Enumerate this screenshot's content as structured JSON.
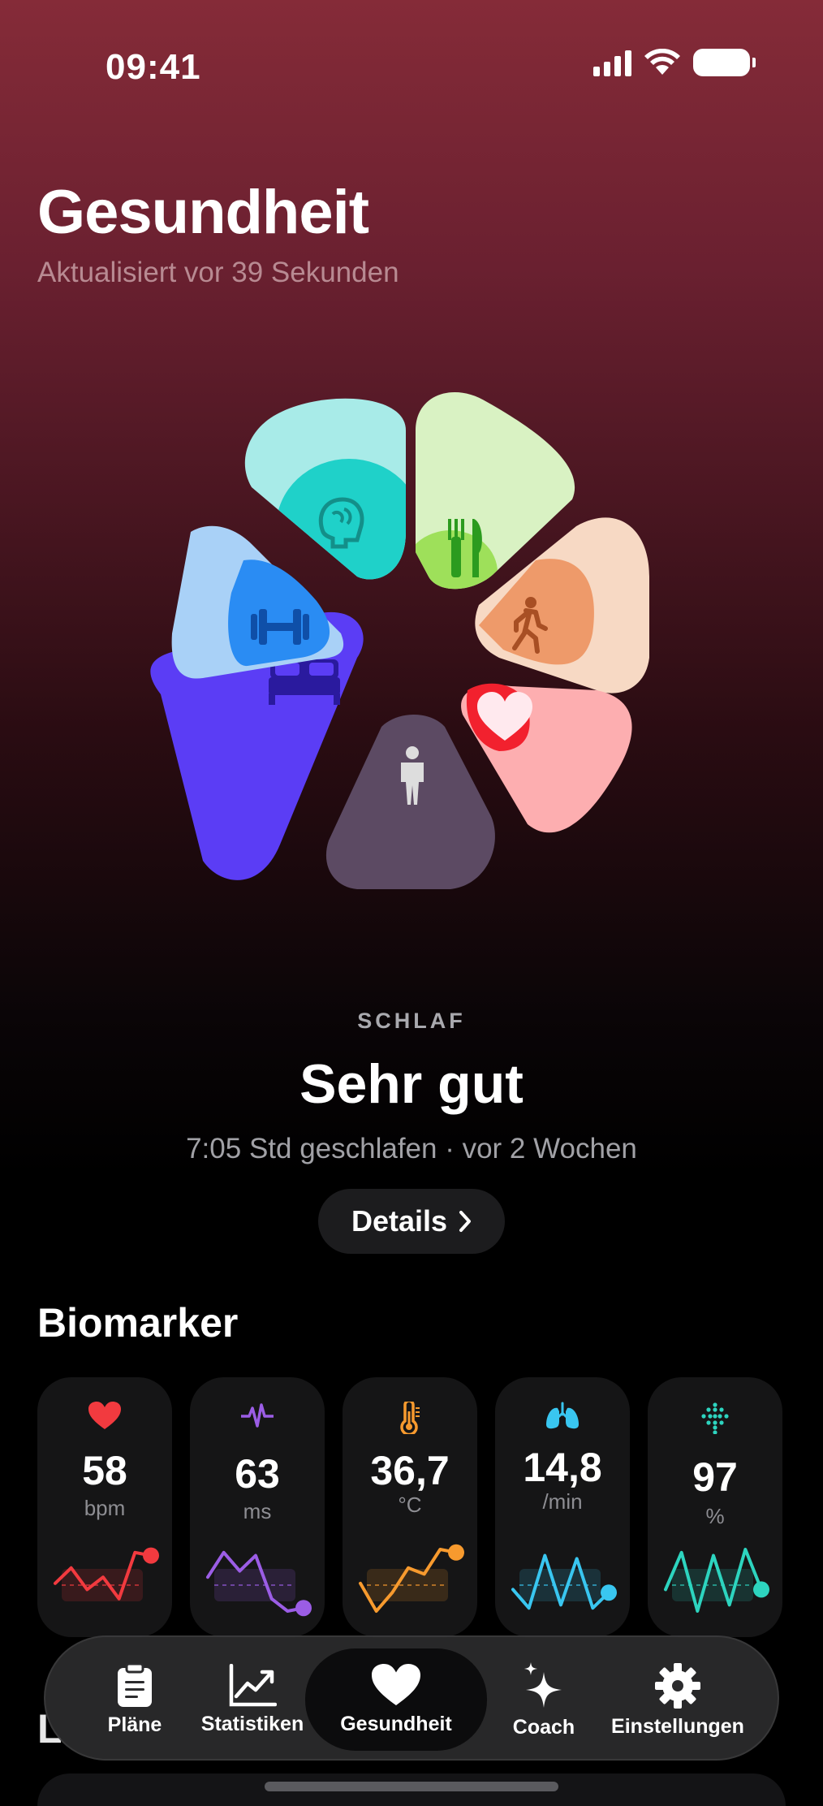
{
  "status_bar": {
    "time": "09:41"
  },
  "header": {
    "title": "Gesundheit",
    "subtitle": "Aktualisiert vor 39 Sekunden"
  },
  "flower": {
    "petals": [
      {
        "name": "mind",
        "icon": "brain-icon",
        "colors": [
          "#a8ebe8",
          "#1fd1c9"
        ]
      },
      {
        "name": "nutrition",
        "icon": "fork-knife-icon",
        "colors": [
          "#d9f2c3",
          "#9ee05a"
        ]
      },
      {
        "name": "activity",
        "icon": "walking-icon",
        "colors": [
          "#f7d9c4",
          "#ee9a6a"
        ]
      },
      {
        "name": "heart",
        "icon": "heart-icon",
        "colors": [
          "#fdaeb0",
          "#f2212e"
        ]
      },
      {
        "name": "body",
        "icon": "person-icon",
        "colors": [
          "#5c4a63",
          "#5c4a63"
        ]
      },
      {
        "name": "sleep",
        "icon": "bed-icon",
        "colors": [
          "#5b3df5",
          "#5b3df5"
        ]
      },
      {
        "name": "fitness",
        "icon": "dumbbell-icon",
        "colors": [
          "#a9d1f7",
          "#2a8cf3"
        ]
      }
    ]
  },
  "summary": {
    "category": "SCHLAF",
    "headline": "Sehr gut",
    "meta": "7:05 Std geschlafen · vor 2 Wochen",
    "details_label": "Details"
  },
  "biomarkers": {
    "title": "Biomarker",
    "cards": [
      {
        "icon": "heart-icon",
        "value": "58",
        "unit": "bpm",
        "color": "#f23a3f",
        "trend": [
          0.45,
          0.7,
          0.35,
          0.55,
          0.2,
          0.95,
          0.9
        ]
      },
      {
        "icon": "heartbeat-icon",
        "value": "63",
        "unit": "ms",
        "color": "#9b5de5",
        "trend": [
          0.55,
          0.95,
          0.65,
          0.9,
          0.2,
          0.0,
          0.05
        ]
      },
      {
        "icon": "thermometer-icon",
        "value": "36,7",
        "unit": "°C",
        "color": "#f79a2e",
        "trend": [
          0.45,
          0.0,
          0.3,
          0.7,
          0.6,
          1.0,
          0.95
        ]
      },
      {
        "icon": "lungs-icon",
        "value": "14,8",
        "unit": "/min",
        "color": "#39c6f0",
        "trend": [
          0.35,
          0.05,
          0.9,
          0.1,
          0.85,
          0.05,
          0.3
        ]
      },
      {
        "icon": "oxygen-icon",
        "value": "97",
        "unit": "%",
        "color": "#2dd4bf",
        "trend": [
          0.35,
          0.95,
          0.0,
          0.9,
          0.1,
          1.0,
          0.35
        ]
      }
    ]
  },
  "tabbar": {
    "items": [
      {
        "label": "Pläne",
        "icon": "clipboard-icon"
      },
      {
        "label": "Statistiken",
        "icon": "chart-icon"
      },
      {
        "label": "Gesundheit",
        "icon": "heart-icon",
        "active": true
      },
      {
        "label": "Coach",
        "icon": "sparkles-icon"
      },
      {
        "label": "Einstellungen",
        "icon": "gear-icon"
      }
    ]
  },
  "below_fold": {
    "section_initial": "L"
  }
}
